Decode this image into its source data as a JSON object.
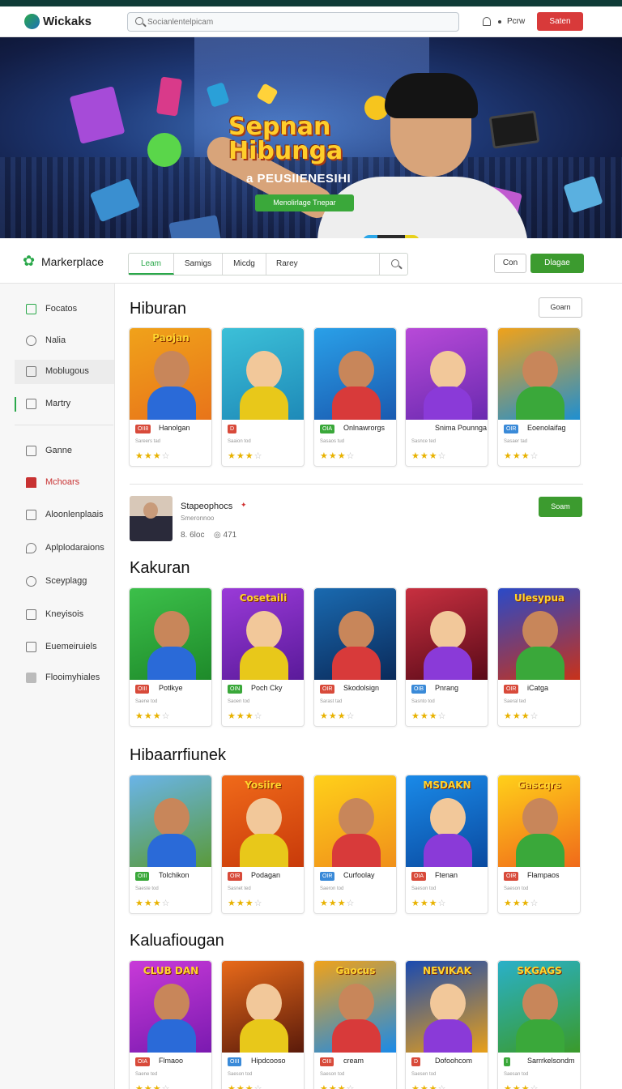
{
  "header": {
    "logo_text": "Wickaks",
    "search_placeholder": "Socianlentelpicam",
    "link": "Pcrw",
    "button": "Saten"
  },
  "hero": {
    "title": "Sepnan Hibunga",
    "subtitle": "a PEUSIIENESIHI",
    "button": "Menolirlage Tnepar"
  },
  "marketplace": {
    "title": "Markerplace",
    "tabs": [
      "Leam",
      "Samigs",
      "Micdg",
      "Rarey"
    ],
    "btn_secondary": "Con",
    "btn_primary": "Dlagae"
  },
  "sidebar": {
    "items": [
      {
        "label": "Focatos",
        "icon": "home-icon"
      },
      {
        "label": "Nalia",
        "icon": "globe-icon"
      },
      {
        "label": "Moblugous",
        "icon": "store-icon"
      },
      {
        "label": "Martry",
        "icon": "bookmark-icon"
      },
      {
        "label": "Ganne",
        "icon": "chart-icon"
      },
      {
        "label": "Mchoars",
        "icon": "car-icon"
      },
      {
        "label": "Aloonlenplaais",
        "icon": "grid-icon"
      },
      {
        "label": "Aplplodaraions",
        "icon": "pin-icon"
      },
      {
        "label": "Sceyplagg",
        "icon": "clock-icon"
      },
      {
        "label": "Kneyisois",
        "icon": "list-icon"
      },
      {
        "label": "Euemeiruiels",
        "icon": "bag-icon"
      },
      {
        "label": "Flooimyhiales",
        "icon": "square-icon"
      }
    ]
  },
  "sections": [
    {
      "title": "Hiburan",
      "button": "Goarn",
      "cards": [
        {
          "tag": "OII8",
          "name": "Hanolgan",
          "meta": "Sareers tad",
          "banner": "Paojan"
        },
        {
          "tag": "D",
          "name": "",
          "meta": "Saaion tod",
          "banner": ""
        },
        {
          "tag": "OIA",
          "name": "Onlnawrorgs",
          "meta": "Sasaos tud",
          "banner": ""
        },
        {
          "tag": "",
          "name": "Snima Pounnga",
          "meta": "Sasnce ted",
          "banner": ""
        },
        {
          "tag": "OIR",
          "name": "Eoenolaifag",
          "meta": "Sasaer tad",
          "banner": ""
        }
      ]
    },
    {
      "title": "Kakuran",
      "cards": [
        {
          "tag": "OIII",
          "name": "Potlkye",
          "meta": "Saene tod",
          "banner": ""
        },
        {
          "tag": "OIN",
          "name": "Poch Cky",
          "meta": "Saoen tod",
          "banner": "Cosetaili"
        },
        {
          "tag": "OIR",
          "name": "Skodolsign",
          "meta": "Sarast tad",
          "banner": ""
        },
        {
          "tag": "OIB",
          "name": "Pnrang",
          "meta": "Sasnto tod",
          "banner": ""
        },
        {
          "tag": "OIR",
          "name": "iCatga",
          "meta": "Saeral ted",
          "banner": "Ulesypua"
        }
      ]
    },
    {
      "title": "Hibaarrfiunek",
      "cards": [
        {
          "tag": "OIII",
          "name": "Tolchikon",
          "meta": "Saeste tod",
          "banner": ""
        },
        {
          "tag": "OIR",
          "name": "Podagan",
          "meta": "Sasnet ted",
          "banner": "Yosiire"
        },
        {
          "tag": "OIR",
          "name": "Curfoolay",
          "meta": "Saeron tod",
          "banner": ""
        },
        {
          "tag": "OIA",
          "name": "Ftenan",
          "meta": "Saeson tod",
          "banner": "MSDAKN"
        },
        {
          "tag": "OIR",
          "name": "Flampaos",
          "meta": "Saeson tod",
          "banner": "Gascqrs"
        }
      ]
    },
    {
      "title": "Kaluafiougan",
      "cards": [
        {
          "tag": "OIA",
          "name": "Flmaoo",
          "meta": "Saene ted",
          "banner": "CLUB DAN"
        },
        {
          "tag": "OIII",
          "name": "Hipdcooso",
          "meta": "Saeson tod",
          "banner": ""
        },
        {
          "tag": "OIII",
          "name": "cream",
          "meta": "Saeson tod",
          "banner": "Gaocus"
        },
        {
          "tag": "D",
          "name": "Dofoohcom",
          "meta": "Saesen tod",
          "banner": "NEVIKAK"
        },
        {
          "tag": "I",
          "name": "Sarrrkelsondm",
          "meta": "Saesan tod",
          "banner": "SKGAGS"
        }
      ]
    }
  ],
  "promo": {
    "title": "Stapeophocs",
    "subtitle": "Smeronnoo",
    "meta1": "8. 6loc",
    "meta2": "◎ 471",
    "button": "Soam"
  }
}
